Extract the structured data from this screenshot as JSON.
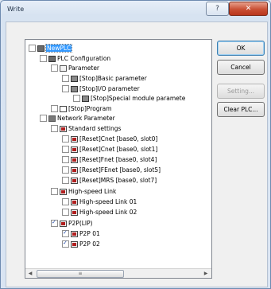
{
  "window": {
    "title": "Write"
  },
  "buttons": {
    "ok": "OK",
    "cancel": "Cancel",
    "setting": "Setting...",
    "clear": "Clear PLC..."
  },
  "tree": {
    "root": "NewPLC",
    "plc_config": "PLC Configuration",
    "parameter": "Parameter",
    "basic": "[Stop]Basic parameter",
    "io": "[Stop]I/O parameter",
    "special": "[Stop]Special module paramete",
    "program": "[Stop]Program",
    "network": "Network Parameter",
    "standard": "Standard settings",
    "s1": "[Reset]Cnet [base0, slot0]",
    "s2": "[Reset]Cnet [base0, slot1]",
    "s3": "[Reset]Fnet [base0, slot4]",
    "s4": "[Reset]FEnet [base0, slot5]",
    "s5": "[Reset]MRS [base0, slot7]",
    "hs": "High-speed Link",
    "hs1": "High-speed Link 01",
    "hs2": "High-speed Link 02",
    "p2p": "P2P(LIP)",
    "p1": "P2P 01",
    "p2": "P2P 02"
  },
  "checked": {
    "p2p": true,
    "p2p01": true,
    "p2p02": true
  }
}
